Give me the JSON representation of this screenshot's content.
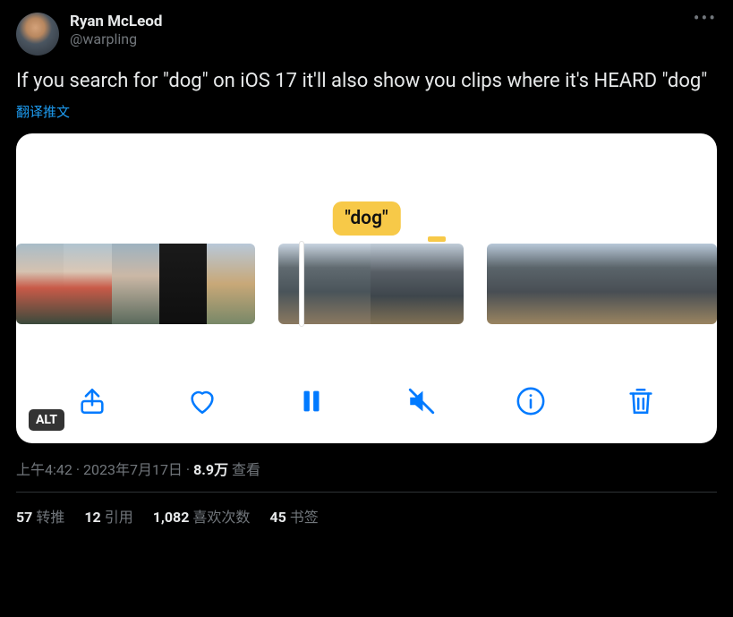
{
  "author": {
    "name": "Ryan McLeod",
    "handle": "@warpling"
  },
  "body": "If you search for \"dog\" on iOS 17 it'll also show you clips where it's HEARD \"dog\"",
  "translate": "翻译推文",
  "media": {
    "caption_pill": "\"dog\"",
    "alt_badge": "ALT"
  },
  "meta": {
    "time": "上午4:42",
    "date": "2023年7月17日",
    "views_num": "8.9万",
    "views_label": "查看"
  },
  "stats": {
    "retweets_num": "57",
    "retweets_label": "转推",
    "quotes_num": "12",
    "quotes_label": "引用",
    "likes_num": "1,082",
    "likes_label": "喜欢次数",
    "bookmarks_num": "45",
    "bookmarks_label": "书签"
  }
}
